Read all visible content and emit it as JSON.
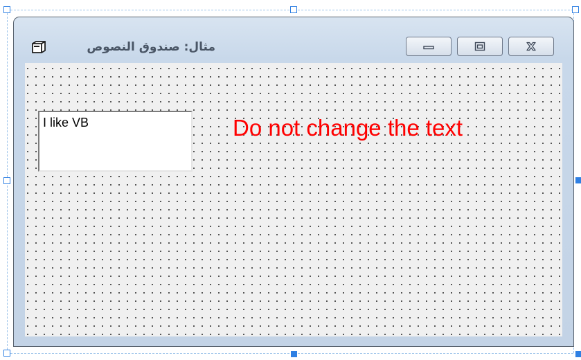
{
  "form": {
    "title": "مثال: صندوق النصوص",
    "textbox_value": "I like VB",
    "label_text": "Do not change the text"
  },
  "titlebar_buttons": [
    {
      "name": "minimize",
      "icon": "minimize-icon"
    },
    {
      "name": "maximize",
      "icon": "maximize-icon"
    },
    {
      "name": "close",
      "icon": "close-icon"
    }
  ],
  "colors": {
    "label_text": "#ff0000",
    "selection_handle": "#2f80e3",
    "client_background": "#f0f0f0"
  }
}
